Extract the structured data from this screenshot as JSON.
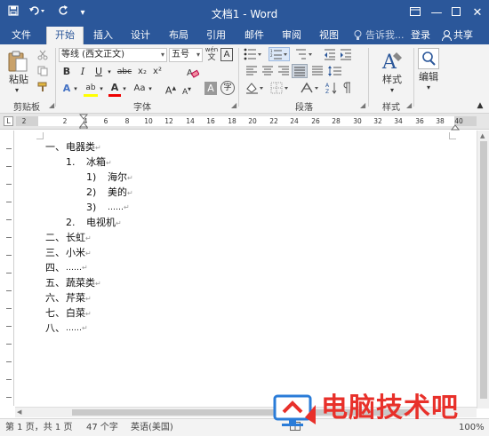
{
  "titlebar": {
    "title": "文档1 - Word",
    "save_icon": "save-icon",
    "undo_icon": "undo-icon",
    "redo_icon": "redo-icon"
  },
  "tabs": [
    {
      "label": "文件"
    },
    {
      "label": "开始",
      "active": true
    },
    {
      "label": "插入"
    },
    {
      "label": "设计"
    },
    {
      "label": "布局"
    },
    {
      "label": "引用"
    },
    {
      "label": "邮件"
    },
    {
      "label": "审阅"
    },
    {
      "label": "视图"
    }
  ],
  "tellme": "告诉我...",
  "signin": "登录",
  "share": "共享",
  "ribbon": {
    "paste_label": "粘贴",
    "clipboard_label": "剪贴板",
    "font_name": "等线 (西文正文)",
    "font_size": "五号",
    "wen_label": "wén",
    "wen_char": "文",
    "a_box": "A",
    "bold": "B",
    "italic": "I",
    "underline": "U",
    "strike": "abc",
    "subscript": "x₂",
    "superscript": "x²",
    "text_effect": "A",
    "highlight": "ab",
    "font_color": "A",
    "change_case": "Aa",
    "grow_font": "A",
    "shrink_font": "A",
    "char_shade": "A",
    "enclose": "字",
    "font_group_label": "字体",
    "paragraph_group_label": "段落",
    "styles_label": "样式",
    "styles_group_label": "样式",
    "editing_label": "编辑"
  },
  "ruler_numbers": [
    "2",
    "2",
    "4",
    "6",
    "8",
    "10",
    "12",
    "14",
    "16",
    "18",
    "20",
    "22",
    "24",
    "26",
    "28",
    "30",
    "32",
    "34",
    "36",
    "38",
    "40"
  ],
  "document": {
    "lines": [
      {
        "marker": "一、",
        "text": "电器类"
      },
      {
        "marker": "1.",
        "text": "冰箱"
      },
      {
        "marker": "1)",
        "text": "海尔"
      },
      {
        "marker": "2)",
        "text": "美的"
      },
      {
        "marker": "3)",
        "text": "……"
      },
      {
        "marker": "2.",
        "text": "电视机"
      },
      {
        "marker": "二、",
        "text": "长虹"
      },
      {
        "marker": "三、",
        "text": "小米"
      },
      {
        "marker": "四、",
        "text": "……"
      },
      {
        "marker": "五、",
        "text": "蔬菜类"
      },
      {
        "marker": "六、",
        "text": "芹菜"
      },
      {
        "marker": "七、",
        "text": "白菜"
      },
      {
        "marker": "八、",
        "text": "……"
      }
    ]
  },
  "status": {
    "page": "第 1 页，共 1 页",
    "words": "47 个字",
    "language": "英语(美国)",
    "zoom": "100%"
  },
  "watermark": {
    "text": "电脑技术吧"
  },
  "colors": {
    "word_blue": "#2b579a",
    "watermark_red": "#e8302a"
  }
}
